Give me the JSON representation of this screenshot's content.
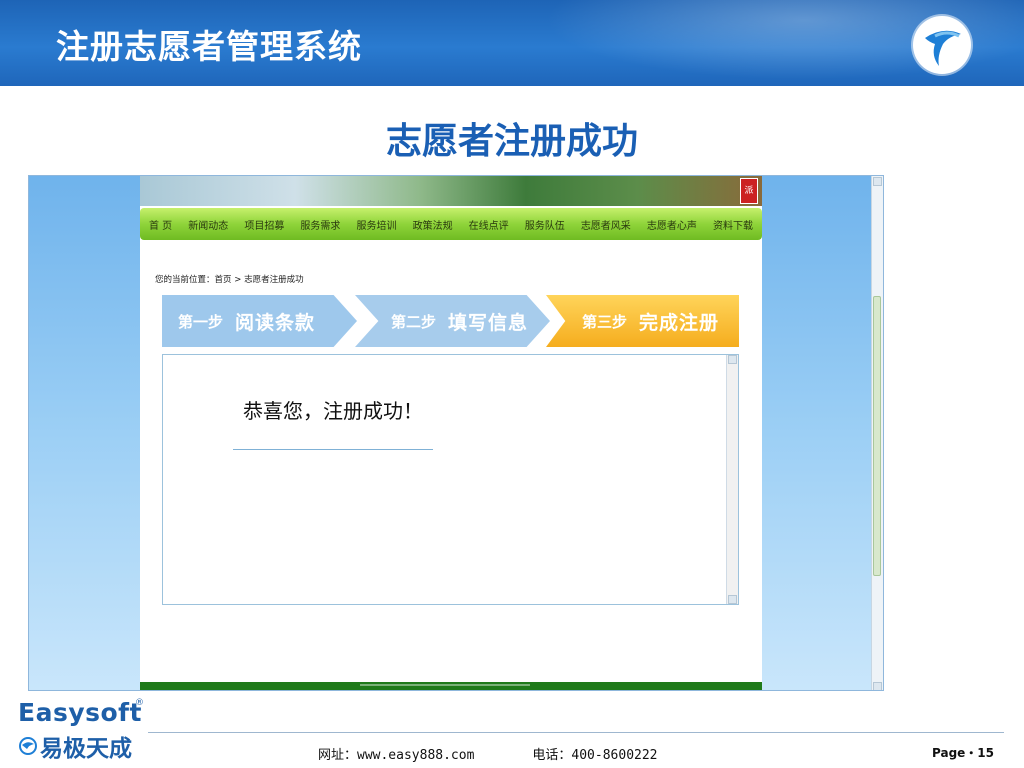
{
  "slide": {
    "title": "注册志愿者管理系统",
    "subtitle": "志愿者注册成功"
  },
  "site": {
    "banner_tag": "派",
    "nav": [
      "首 页",
      "新闻动态",
      "项目招募",
      "服务需求",
      "服务培训",
      "政策法规",
      "在线点评",
      "服务队伍",
      "志愿者风采",
      "志愿者心声",
      "资料下载"
    ],
    "breadcrumb": {
      "prefix": "您的当前位置：",
      "home": "首页",
      "separator": " > ",
      "current": "志愿者注册成功"
    },
    "steps": [
      {
        "num": "第一步",
        "text": "阅读条款",
        "state": "done"
      },
      {
        "num": "第二步",
        "text": "填写信息",
        "state": "done"
      },
      {
        "num": "第三步",
        "text": "完成注册",
        "state": "current"
      }
    ],
    "success_message": "恭喜您，注册成功！"
  },
  "footer": {
    "brand_en": "Easysoft",
    "brand_reg": "®",
    "brand_cn": "易极天成",
    "website": "网址：www.easy888.com",
    "phone": "电话：400-8600222",
    "page": "Page・15"
  },
  "colors": {
    "header_blue": "#1e64b6",
    "subtitle_blue": "#1a5fb4",
    "nav_green": "#8fd43a",
    "step_done": "#9ec8ec",
    "step_current": "#f5ad1e"
  }
}
